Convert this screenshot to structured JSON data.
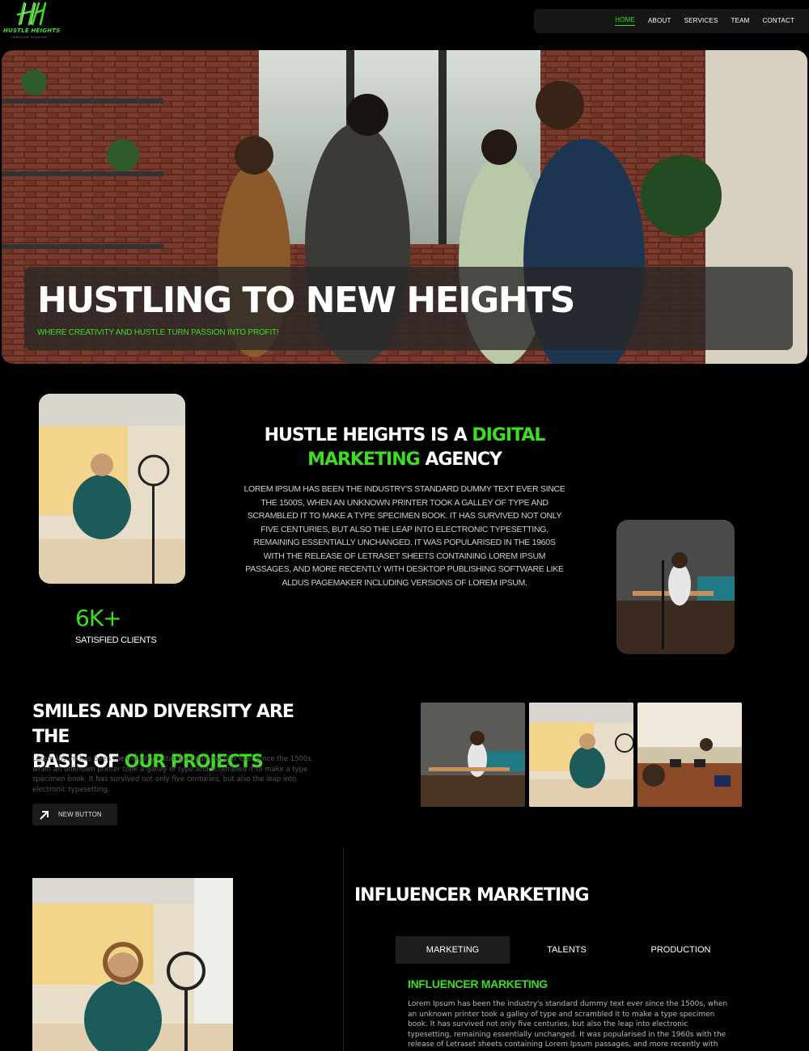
{
  "brand": {
    "name": "HUSTLE HEIGHTS",
    "tagline": "CREATIVE STUDIOS",
    "accent": "#39e01d"
  },
  "nav": {
    "items": [
      "HOME",
      "ABOUT",
      "SERVICES",
      "TEAM",
      "CONTACT"
    ],
    "active": "HOME"
  },
  "hero": {
    "title": "HUSTLING TO NEW HEIGHTS",
    "subtitle": "WHERE CREATIVITY AND HUSTLE TURN PASSION INTO PROFIT!"
  },
  "about": {
    "title_pre": "HUSTLE HEIGHTS IS A ",
    "title_green1": "DIGITAL",
    "title_green2": "MARKETING",
    "title_post": " AGENCY",
    "body": "LOREM IPSUM HAS BEEN THE INDUSTRY'S STANDARD DUMMY TEXT EVER SINCE THE 1500S, WHEN AN UNKNOWN PRINTER TOOK A GALLEY OF TYPE AND SCRAMBLED IT TO MAKE A TYPE SPECIMEN BOOK. IT HAS SURVIVED NOT ONLY FIVE CENTURIES, BUT ALSO THE LEAP INTO ELECTRONIC TYPESETTING, REMAINING ESSENTIALLY UNCHANGED. IT WAS POPULARISED IN THE 1960S WITH THE RELEASE OF LETRASET SHEETS CONTAINING LOREM IPSUM PASSAGES, AND MORE RECENTLY WITH DESKTOP PUBLISHING SOFTWARE LIKE ALDUS PAGEMAKER INCLUDING VERSIONS OF LOREM IPSUM.",
    "stat_value": "6K+",
    "stat_label": "SATISFIED CLIENTS"
  },
  "projects": {
    "title_line1": "SMILES AND DIVERSITY ARE THE",
    "title_pre2": "BASIS OF ",
    "title_green": "OUR PROJECTS",
    "body": "Lorem Ipsum has been the industry's standard dummy text ever since the 1500s, when an unknown printer took a galley of type and scrambled it to make a type specimen book. It has survived not only five centuries, but also the leap into electronic typesetting.",
    "button": "NEW BUTTON"
  },
  "influencer": {
    "title": "INFLUENCER MARKETING",
    "tabs": [
      "MARKETING",
      "TALENTS",
      "PRODUCTION"
    ],
    "active_tab": "MARKETING",
    "subtitle": "INFLUENCER MARKETING",
    "body": "Lorem Ipsum has been the industry's standard dummy text ever since the 1500s, when an unknown printer took a galley of type and scrambled it to make a type specimen book. It has survived not only five centuries, but also the leap into electronic typesetting, remaining essentially unchanged. It was popularised in the 1960s with the release of Letraset sheets containing Lorem Ipsum passages, and more recently with desktop"
  }
}
